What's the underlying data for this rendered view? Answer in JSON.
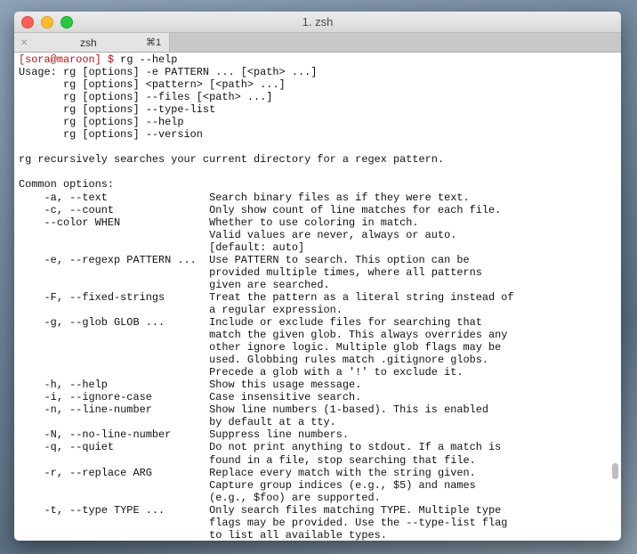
{
  "window": {
    "title": "1. zsh"
  },
  "tab": {
    "close_icon": "×",
    "title": "zsh",
    "shortcut": "⌘1"
  },
  "terminal": {
    "prompt": "[sora@maroon] $",
    "command": " rg --help",
    "lines": [
      "Usage: rg [options] -e PATTERN ... [<path> ...]",
      "       rg [options] <pattern> [<path> ...]",
      "       rg [options] --files [<path> ...]",
      "       rg [options] --type-list",
      "       rg [options] --help",
      "       rg [options] --version",
      "",
      "rg recursively searches your current directory for a regex pattern.",
      "",
      "Common options:",
      "    -a, --text                Search binary files as if they were text.",
      "    -c, --count               Only show count of line matches for each file.",
      "    --color WHEN              Whether to use coloring in match.",
      "                              Valid values are never, always or auto.",
      "                              [default: auto]",
      "    -e, --regexp PATTERN ...  Use PATTERN to search. This option can be",
      "                              provided multiple times, where all patterns",
      "                              given are searched.",
      "    -F, --fixed-strings       Treat the pattern as a literal string instead of",
      "                              a regular expression.",
      "    -g, --glob GLOB ...       Include or exclude files for searching that",
      "                              match the given glob. This always overrides any",
      "                              other ignore logic. Multiple glob flags may be",
      "                              used. Globbing rules match .gitignore globs.",
      "                              Precede a glob with a '!' to exclude it.",
      "    -h, --help                Show this usage message.",
      "    -i, --ignore-case         Case insensitive search.",
      "    -n, --line-number         Show line numbers (1-based). This is enabled",
      "                              by default at a tty.",
      "    -N, --no-line-number      Suppress line numbers.",
      "    -q, --quiet               Do not print anything to stdout. If a match is",
      "                              found in a file, stop searching that file.",
      "    -r, --replace ARG         Replace every match with the string given.",
      "                              Capture group indices (e.g., $5) and names",
      "                              (e.g., $foo) are supported.",
      "    -t, --type TYPE ...       Only search files matching TYPE. Multiple type",
      "                              flags may be provided. Use the --type-list flag",
      "                              to list all available types."
    ]
  },
  "colors": {
    "prompt": "#b0141a",
    "close": "#fc5f57",
    "minimize": "#fdbc2e",
    "zoom": "#28c840"
  }
}
